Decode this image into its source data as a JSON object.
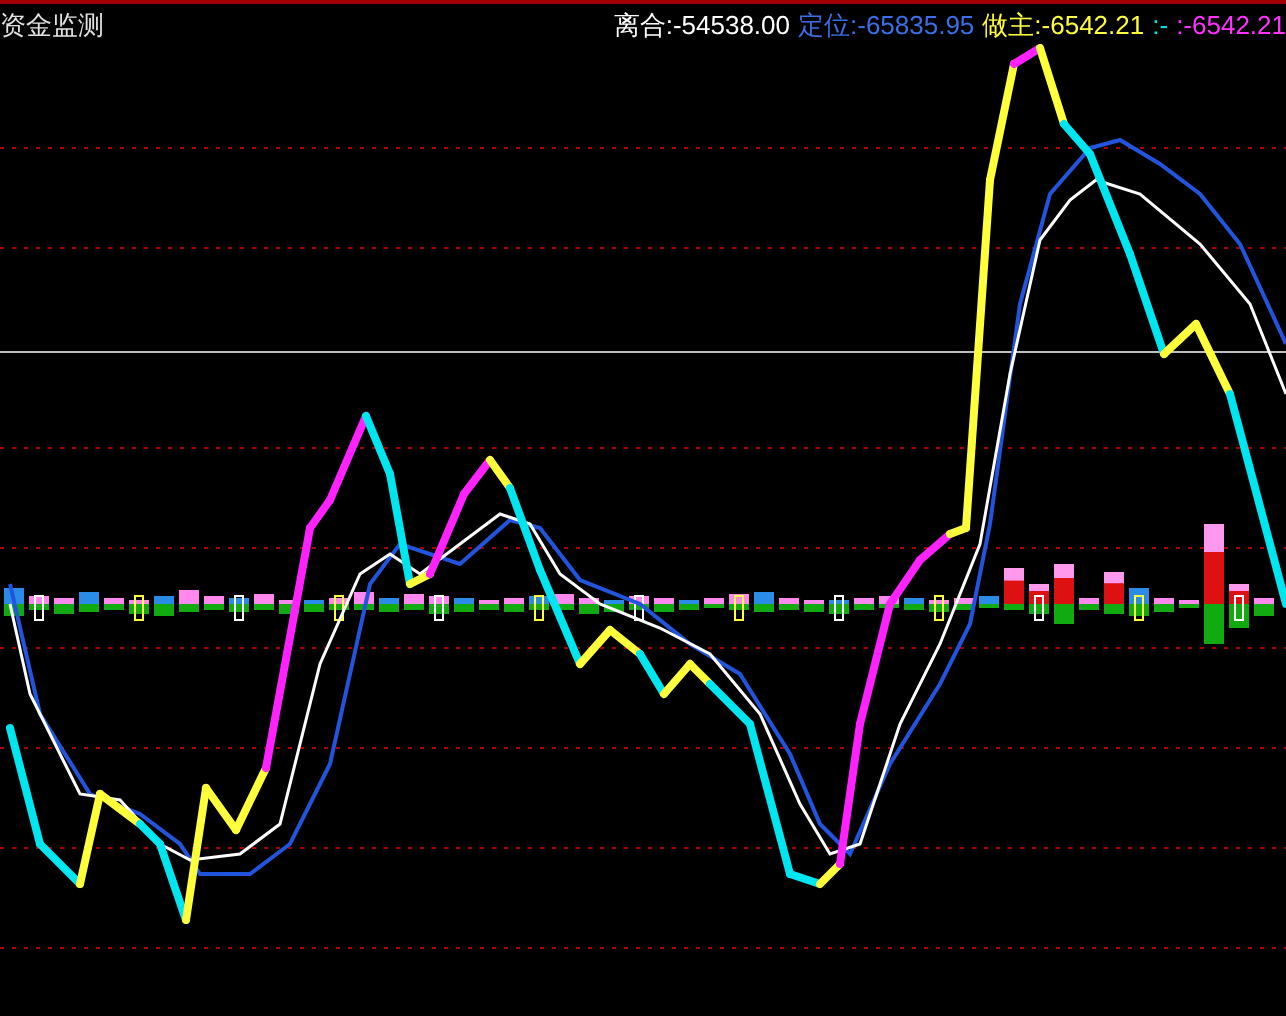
{
  "title": "资金监测",
  "legend": [
    {
      "text": "离合:-54538.00",
      "color": "#ffffff"
    },
    {
      "text": "定位:-65835.95",
      "color": "#3b6fe8"
    },
    {
      "text": "做主:-6542.21",
      "color": "#ffff3c"
    },
    {
      "text": ":-",
      "color": "#00e6e6"
    },
    {
      "text": ":-6542.21",
      "color": "#ff33ff"
    }
  ]
}
